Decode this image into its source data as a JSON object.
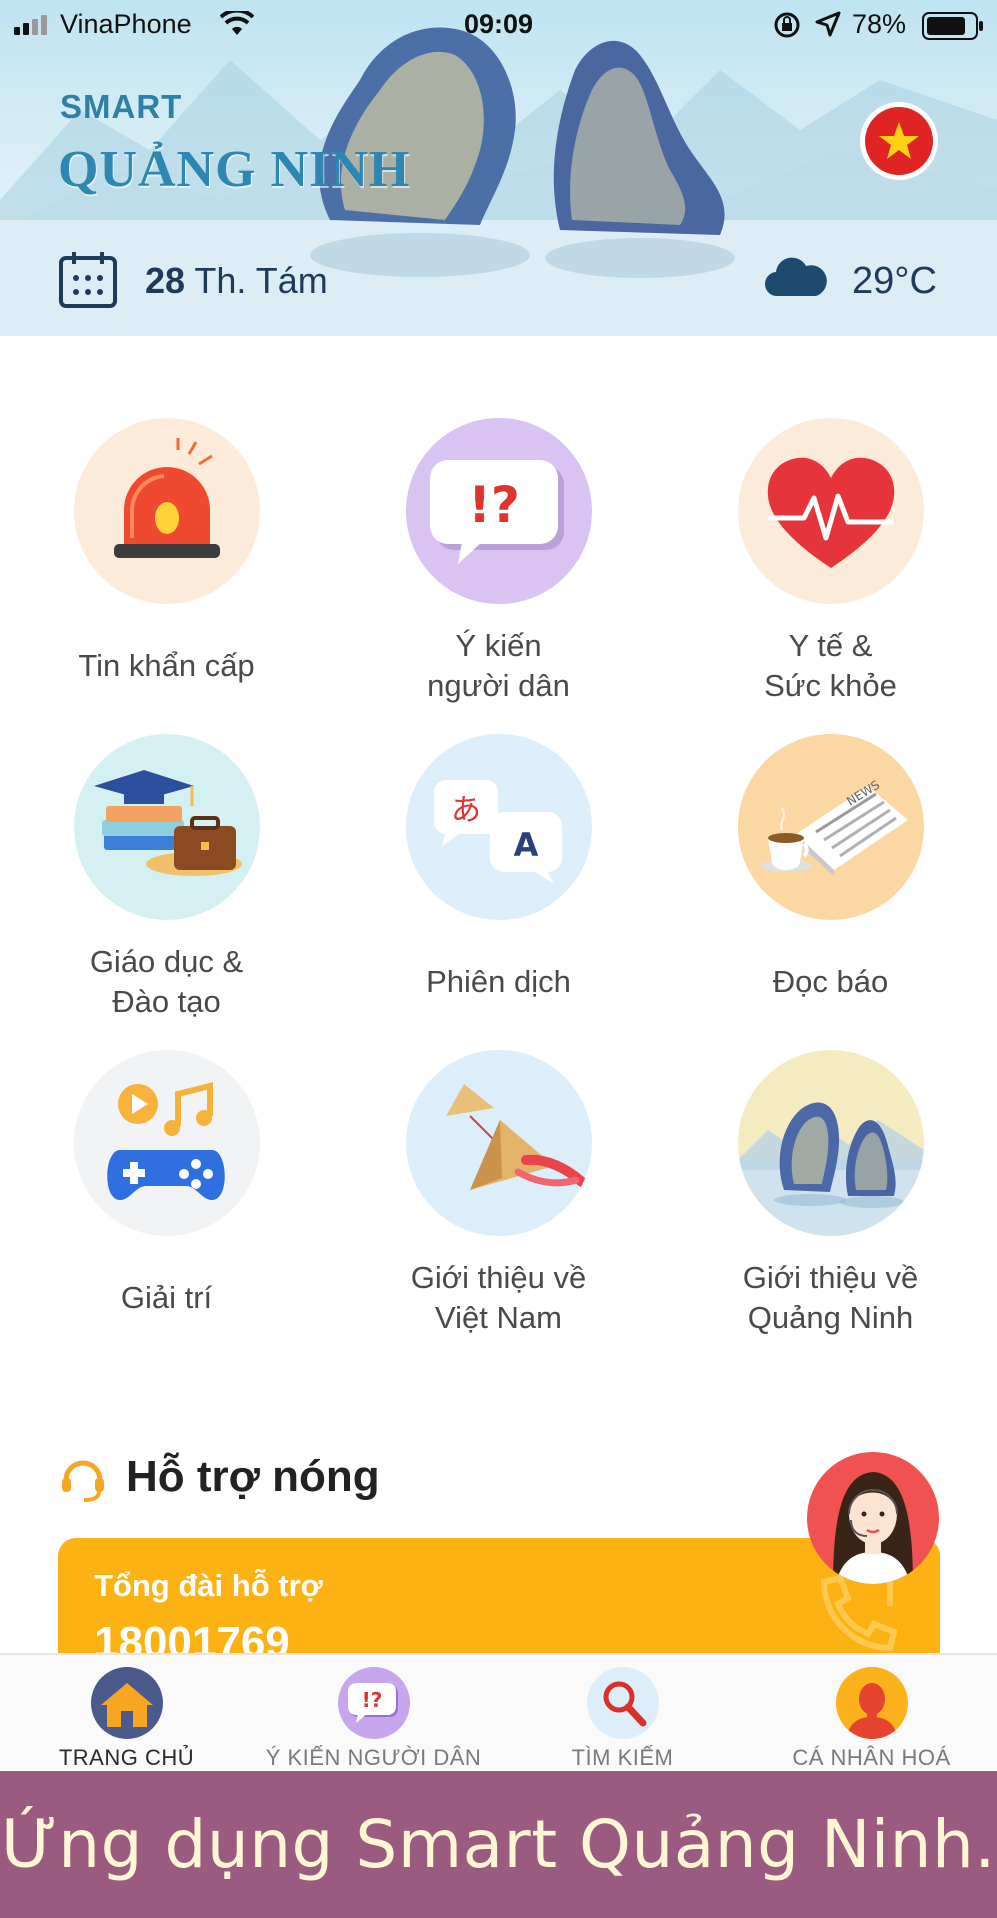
{
  "status_bar": {
    "carrier": "VinaPhone",
    "time": "09:09",
    "battery_percent": "78%"
  },
  "header": {
    "brand_small": "SMART",
    "brand_big": "QUẢNG NINH",
    "date_day": "28",
    "date_month": "Th. Tám",
    "temperature": "29°C"
  },
  "grid": {
    "items": [
      {
        "label": "Tin khẩn cấp",
        "icon": "siren-icon",
        "bg": "#fdebd9"
      },
      {
        "label": "Ý kiến\nngười dân",
        "icon": "feedback-bubble-icon",
        "bg": "#d9c3f2"
      },
      {
        "label": "Y tế &\nSức khỏe",
        "icon": "heart-pulse-icon",
        "bg": "#fdebd9"
      },
      {
        "label": "Giáo dục &\nĐào tạo",
        "icon": "education-icon",
        "bg": "#d4f0f2"
      },
      {
        "label": "Phiên dịch",
        "icon": "translate-icon",
        "bg": "#dceefa"
      },
      {
        "label": "Đọc báo",
        "icon": "newspaper-icon",
        "bg": "#fbd7a3"
      },
      {
        "label": "Giải trí",
        "icon": "gamepad-music-icon",
        "bg": "#f1f3f5"
      },
      {
        "label": "Giới thiệu về\nViệt Nam",
        "icon": "conical-hat-icon",
        "bg": "#dceefa"
      },
      {
        "label": "Giới thiệu về\nQuảng Ninh",
        "icon": "halong-rocks-icon",
        "bg": "#f4ecc0"
      }
    ]
  },
  "hot_support": {
    "title": "Hỗ trợ nóng",
    "card_label": "Tổng đài hỗ trợ",
    "card_number": "18001769"
  },
  "bottom_nav": {
    "items": [
      {
        "label": "TRANG CHỦ",
        "icon": "home-icon"
      },
      {
        "label": "Ý KIẾN NGƯỜI DÂN",
        "icon": "feedback-icon"
      },
      {
        "label": "TÌM KIẾM",
        "icon": "search-icon"
      },
      {
        "label": "CÁ NHÂN HOÁ",
        "icon": "profile-icon"
      }
    ]
  },
  "caption": "Ứng dụng Smart Quảng Ninh.",
  "colors": {
    "accent_orange": "#fdb213",
    "brand_blue": "#2f86b0",
    "caption_bg": "#9b5a80"
  }
}
